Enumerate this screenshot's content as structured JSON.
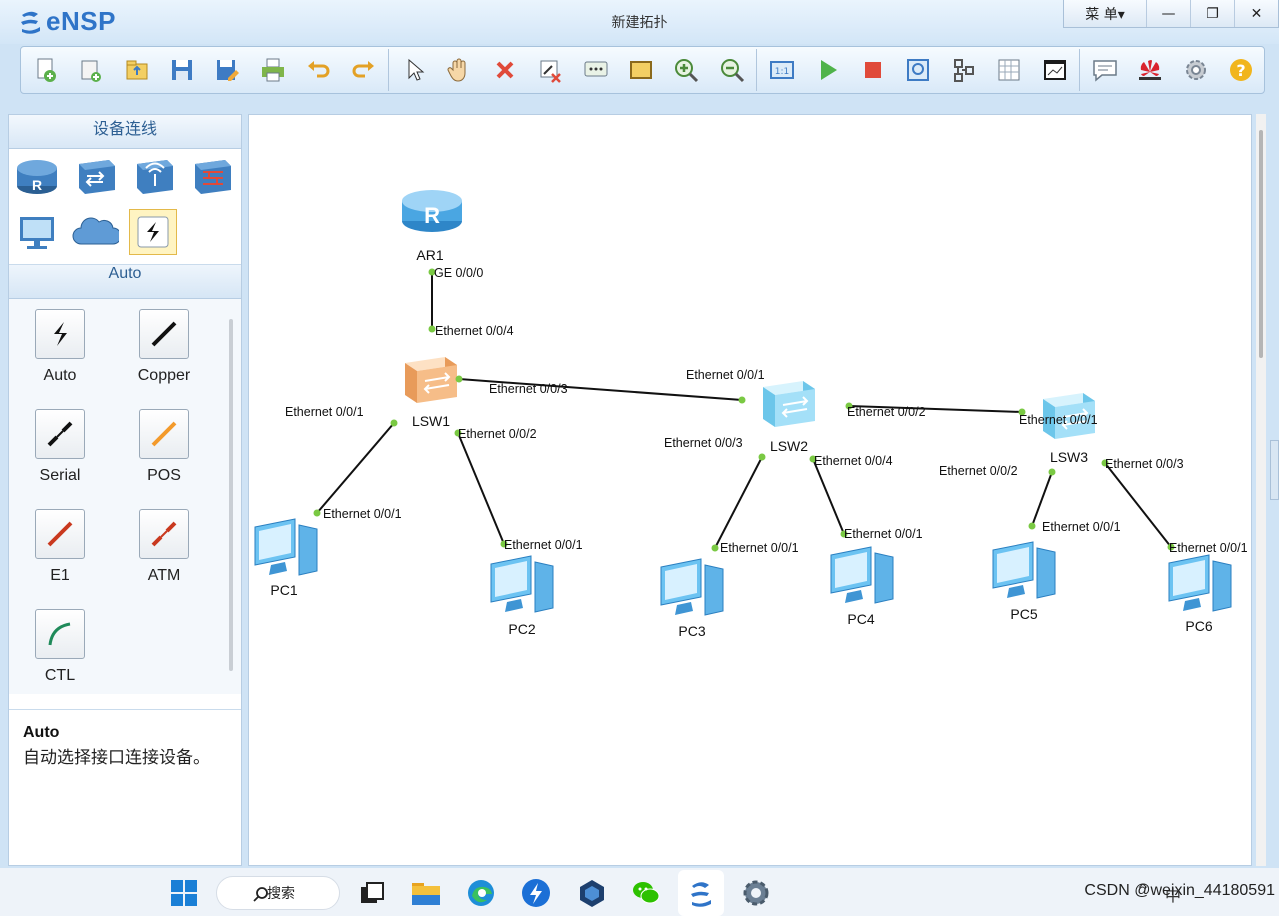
{
  "app": {
    "logo": "eNSP",
    "window_title": "新建拓扑",
    "menu_label": "菜 单▾"
  },
  "window_controls": {
    "minimize": "—",
    "restore": "❐",
    "close": "✕"
  },
  "toolbar": {
    "buttons": [
      "new-topology-icon",
      "new-example-icon",
      "open-icon",
      "save-icon",
      "save-as-icon",
      "print-icon",
      "undo-icon",
      "redo-icon",
      "select-pointer-icon",
      "hand-pan-icon",
      "delete-icon",
      "delete-links-icon",
      "text-label-icon",
      "rectangle-icon",
      "zoom-in-icon",
      "zoom-out-icon",
      "fit-view-icon",
      "start-device-icon",
      "stop-device-icon",
      "capture-data-icon",
      "topology-display-icon",
      "grid-icon",
      "command-line-icon",
      "chat-icon",
      "huawei-icon",
      "settings-icon",
      "help-icon"
    ]
  },
  "left_panel": {
    "title": "设备连线",
    "device_categories": [
      "router-icon",
      "switch-icon",
      "wlan-icon",
      "firewall-icon",
      "terminal-pc-icon",
      "cloud-icon",
      "connection-icon"
    ],
    "subtitle": "Auto",
    "cables": [
      {
        "name": "Auto",
        "icon": "auto-cable-icon"
      },
      {
        "name": "Copper",
        "icon": "copper-cable-icon"
      },
      {
        "name": "Serial",
        "icon": "serial-cable-icon"
      },
      {
        "name": "POS",
        "icon": "pos-cable-icon"
      },
      {
        "name": "E1",
        "icon": "e1-cable-icon"
      },
      {
        "name": "ATM",
        "icon": "atm-cable-icon"
      },
      {
        "name": "CTL",
        "icon": "ctl-cable-icon"
      }
    ],
    "description": {
      "title": "Auto",
      "text": "自动选择接口连接设备。"
    }
  },
  "topology": {
    "devices": [
      {
        "name": "AR1",
        "type": "router"
      },
      {
        "name": "LSW1",
        "type": "switch-orange"
      },
      {
        "name": "LSW2",
        "type": "switch"
      },
      {
        "name": "LSW3",
        "type": "switch"
      },
      {
        "name": "PC1",
        "type": "pc"
      },
      {
        "name": "PC2",
        "type": "pc"
      },
      {
        "name": "PC3",
        "type": "pc"
      },
      {
        "name": "PC4",
        "type": "pc"
      },
      {
        "name": "PC5",
        "type": "pc"
      },
      {
        "name": "PC6",
        "type": "pc"
      }
    ],
    "links": [
      {
        "from": "AR1",
        "from_port": "GE 0/0/0",
        "to": "LSW1",
        "to_port": "Ethernet 0/0/4"
      },
      {
        "from": "LSW1",
        "from_port": "Ethernet 0/0/3",
        "to": "LSW2",
        "to_port": "Ethernet 0/0/1"
      },
      {
        "from": "LSW2",
        "from_port": "Ethernet 0/0/2",
        "to": "LSW3",
        "to_port": "Ethernet 0/0/1"
      },
      {
        "from": "LSW1",
        "from_port": "Ethernet 0/0/1",
        "to": "PC1",
        "to_port": "Ethernet 0/0/1"
      },
      {
        "from": "LSW1",
        "from_port": "Ethernet 0/0/2",
        "to": "PC2",
        "to_port": "Ethernet 0/0/1"
      },
      {
        "from": "LSW2",
        "from_port": "Ethernet 0/0/3",
        "to": "PC3",
        "to_port": "Ethernet 0/0/1"
      },
      {
        "from": "LSW2",
        "from_port": "Ethernet 0/0/4",
        "to": "PC4",
        "to_port": "Ethernet 0/0/1"
      },
      {
        "from": "LSW3",
        "from_port": "Ethernet 0/0/2",
        "to": "PC5",
        "to_port": "Ethernet 0/0/1"
      },
      {
        "from": "LSW3",
        "from_port": "Ethernet 0/0/3",
        "to": "PC6",
        "to_port": "Ethernet 0/0/1"
      }
    ]
  },
  "taskbar": {
    "search_label": "搜索",
    "apps": [
      "windows-start-icon",
      "search-icon",
      "task-view-icon",
      "file-explorer-icon",
      "edge-icon",
      "thunder-icon",
      "virtualbox-icon",
      "wechat-icon",
      "ensp-icon",
      "settings-gear-icon"
    ],
    "tray_caret": "^",
    "tray_ime": "中",
    "tray_text": "CSDN @weixin_44180591"
  }
}
